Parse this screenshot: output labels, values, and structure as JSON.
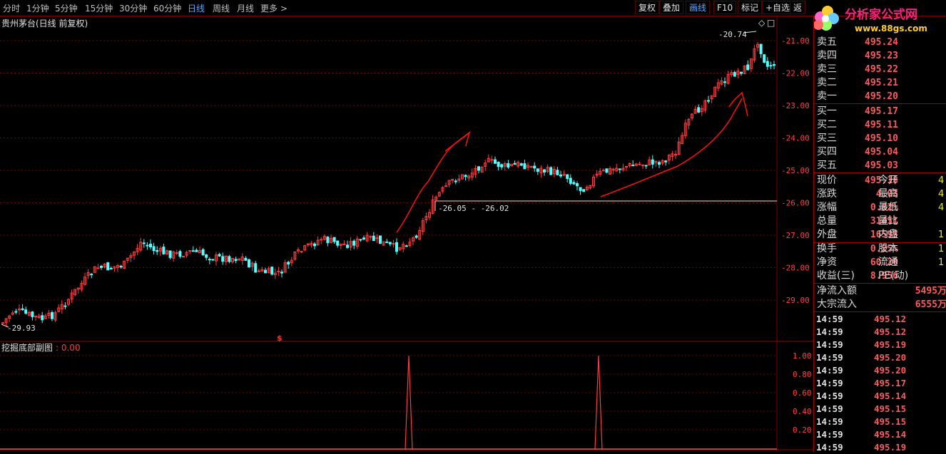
{
  "toolbar": {
    "periods": [
      "分时",
      "1分钟",
      "5分钟",
      "15分钟",
      "30分钟",
      "60分钟",
      "日线",
      "周线",
      "月线",
      "更多 >"
    ],
    "active_period": "日线",
    "buttons": [
      "复权",
      "叠加",
      "画线",
      "F10",
      "标记",
      "+自选",
      "返"
    ]
  },
  "chart": {
    "title": "贵州茅台(日线 前复权)",
    "price_ticks": [
      "-21.00",
      "-22.00",
      "-23.00",
      "-24.00",
      "-25.00",
      "-26.00",
      "-27.00",
      "-28.00",
      "-29.00"
    ],
    "annotations": {
      "high": "-20.74",
      "low": "-29.93",
      "range": "-26.05 - -26.02",
      "marker": "$"
    },
    "sub_title": "挖掘底部副图",
    "sub_value": ": 0.00",
    "sub_ticks": [
      "1.00",
      "0.80",
      "0.60",
      "0.40",
      "0.20"
    ],
    "colors": {
      "up": "#ff3c3c",
      "down": "#54ffff",
      "grid": "#7a0000",
      "annotation": "#ff1010"
    }
  },
  "logo": {
    "text": "分析家公式网",
    "url": "www.88gs.com"
  },
  "orderbook": {
    "asks": [
      {
        "label": "卖五",
        "price": "495.24"
      },
      {
        "label": "卖四",
        "price": "495.23"
      },
      {
        "label": "卖三",
        "price": "495.22"
      },
      {
        "label": "卖二",
        "price": "495.21"
      },
      {
        "label": "卖一",
        "price": "495.20"
      }
    ],
    "bids": [
      {
        "label": "买一",
        "price": "495.17"
      },
      {
        "label": "买二",
        "price": "495.11"
      },
      {
        "label": "买三",
        "price": "495.10"
      },
      {
        "label": "买四",
        "price": "495.04"
      },
      {
        "label": "买五",
        "price": "495.03"
      }
    ]
  },
  "quote": [
    {
      "l": "现价",
      "v": "495.18",
      "l2": "今开",
      "v2": "4"
    },
    {
      "l": "涨跌",
      "v": "4.03",
      "l2": "最高",
      "v2": "4"
    },
    {
      "l": "涨幅",
      "v": "0.82%",
      "l2": "最低",
      "v2": "4"
    },
    {
      "l": "总量",
      "v": "31451",
      "l2": "量比",
      "v2": ""
    },
    {
      "l": "外盘",
      "v": "16595",
      "l2": "内盘",
      "v2": "1"
    }
  ],
  "fundamentals": [
    {
      "l": "换手",
      "v": "0.25%",
      "l2": "股本",
      "v2": "1"
    },
    {
      "l": "净资",
      "v": "60.20",
      "l2": "流通",
      "v2": "1"
    },
    {
      "l": "收益(三)",
      "v": "8.956",
      "l2": "PE(动)",
      "v2": ""
    }
  ],
  "flows": [
    {
      "l": "净流入额",
      "v": "5495万"
    },
    {
      "l": "大宗流入",
      "v": "6555万"
    }
  ],
  "ticks": [
    {
      "t": "14:59",
      "p": "495.12"
    },
    {
      "t": "14:59",
      "p": "495.12"
    },
    {
      "t": "14:59",
      "p": "495.19"
    },
    {
      "t": "14:59",
      "p": "495.20"
    },
    {
      "t": "14:59",
      "p": "495.20"
    },
    {
      "t": "14:59",
      "p": "495.17"
    },
    {
      "t": "14:59",
      "p": "495.14"
    },
    {
      "t": "14:59",
      "p": "495.15"
    },
    {
      "t": "14:59",
      "p": "495.15"
    },
    {
      "t": "14:59",
      "p": "495.14"
    },
    {
      "t": "14:59",
      "p": "495.19"
    }
  ]
}
